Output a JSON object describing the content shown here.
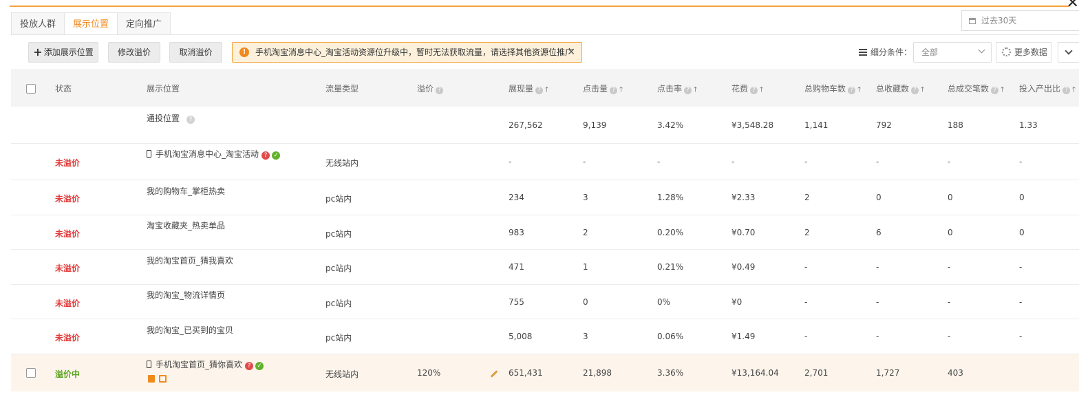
{
  "tabs": [
    "投放人群",
    "展示位置",
    "定向推广"
  ],
  "active_tab": "展示位置",
  "date_range": "过去30天",
  "toolbar": {
    "add_label": "添加展示位置",
    "modify_label": "修改溢价",
    "cancel_label": "取消溢价"
  },
  "notice": "手机淘宝消息中心_淘宝活动资源位升级中，暂时无法获取流量，请选择其他资源位推广",
  "filter": {
    "label": "细分条件：",
    "value": "全部",
    "more_label": "更多数据"
  },
  "columns": {
    "status": "状态",
    "position": "展示位置",
    "traffic": "流量类型",
    "premium": "溢价",
    "impressions": "展现量",
    "clicks": "点击量",
    "ctr": "点击率",
    "cost": "花费",
    "cart": "总购物车数",
    "fav": "总收藏数",
    "orders": "总成交笔数",
    "roi": "投入产出比"
  },
  "rows": [
    {
      "status": "",
      "position": "通投位置",
      "traffic": "",
      "premium": "",
      "impressions": "267,562",
      "clicks": "9,139",
      "ctr": "3.42%",
      "cost": "¥3,548.28",
      "cart": "1,141",
      "fav": "792",
      "orders": "188",
      "roi": "1.33"
    },
    {
      "status": "未溢价",
      "position": "手机淘宝消息中心_淘宝活动",
      "traffic": "无线站内",
      "premium": "",
      "impressions": "-",
      "clicks": "-",
      "ctr": "-",
      "cost": "-",
      "cart": "-",
      "fav": "-",
      "orders": "-",
      "roi": "-"
    },
    {
      "status": "未溢价",
      "position": "我的购物车_掌柜热卖",
      "traffic": "pc站内",
      "premium": "",
      "impressions": "234",
      "clicks": "3",
      "ctr": "1.28%",
      "cost": "¥2.33",
      "cart": "2",
      "fav": "0",
      "orders": "0",
      "roi": "0"
    },
    {
      "status": "未溢价",
      "position": "淘宝收藏夹_热卖单品",
      "traffic": "pc站内",
      "premium": "",
      "impressions": "983",
      "clicks": "2",
      "ctr": "0.20%",
      "cost": "¥0.70",
      "cart": "2",
      "fav": "6",
      "orders": "0",
      "roi": "0"
    },
    {
      "status": "未溢价",
      "position": "我的淘宝首页_猜我喜欢",
      "traffic": "pc站内",
      "premium": "",
      "impressions": "471",
      "clicks": "1",
      "ctr": "0.21%",
      "cost": "¥0.49",
      "cart": "-",
      "fav": "-",
      "orders": "-",
      "roi": "-"
    },
    {
      "status": "未溢价",
      "position": "我的淘宝_物流详情页",
      "traffic": "pc站内",
      "premium": "",
      "impressions": "755",
      "clicks": "0",
      "ctr": "0%",
      "cost": "¥0",
      "cart": "-",
      "fav": "-",
      "orders": "-",
      "roi": "-"
    },
    {
      "status": "未溢价",
      "position": "我的淘宝_已买到的宝贝",
      "traffic": "pc站内",
      "premium": "",
      "impressions": "5,008",
      "clicks": "3",
      "ctr": "0.06%",
      "cost": "¥1.49",
      "cart": "-",
      "fav": "-",
      "orders": "-",
      "roi": "-"
    },
    {
      "status": "溢价中",
      "position": "手机淘宝首页_猜你喜欢",
      "traffic": "无线站内",
      "premium": "120%",
      "impressions": "651,431",
      "clicks": "21,898",
      "ctr": "3.36%",
      "cost": "¥13,164.04",
      "cart": "2,701",
      "fav": "1,727",
      "orders": "403",
      "roi": ""
    }
  ]
}
